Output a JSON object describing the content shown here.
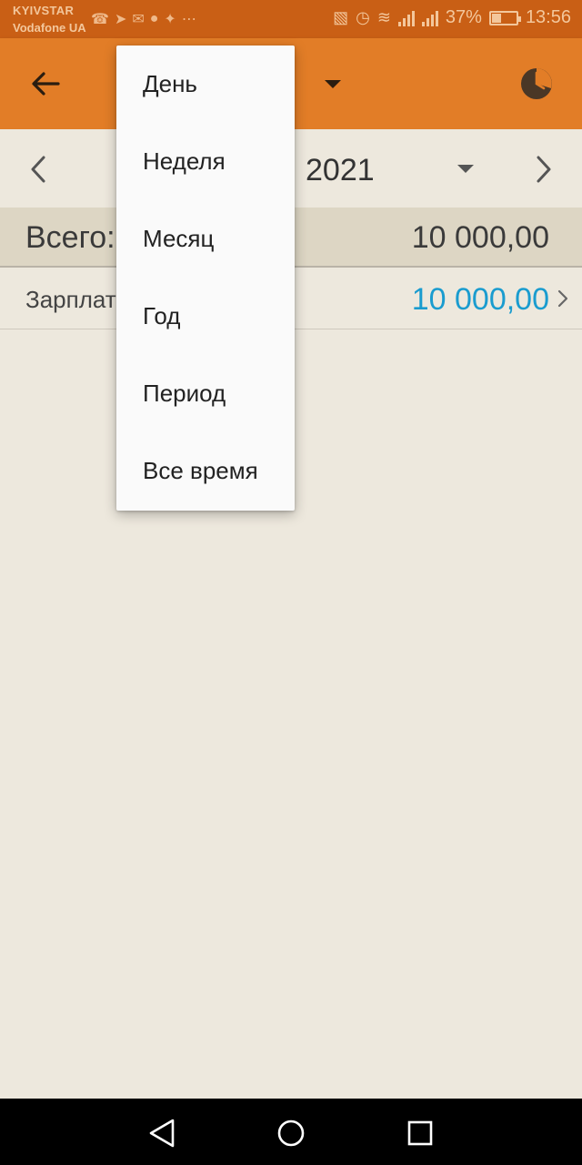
{
  "status_bar": {
    "carrier_1": "KYIVSTAR",
    "carrier_2": "Vodafone UA",
    "app_icons": [
      "viber-icon",
      "telegram-icon",
      "gmail-icon",
      "app-icon",
      "app-icon",
      "more-icon"
    ],
    "battery_percent": "37%",
    "battery_level": 0.37,
    "time": "13:56"
  },
  "app_bar": {
    "colors": {
      "status": "#c95f15",
      "bar": "#e27d27"
    }
  },
  "period": {
    "label": "2021"
  },
  "summary": {
    "total_label": "Всего:",
    "total_value": "10 000,00"
  },
  "categories": [
    {
      "label": "Зарплата",
      "value": "10 000,00",
      "value_color": "#1a9ccf"
    }
  ],
  "dropdown": {
    "items": [
      "День",
      "Неделя",
      "Месяц",
      "Год",
      "Период",
      "Все время"
    ]
  },
  "nav": {
    "icons": [
      "back-triangle-icon",
      "home-circle-icon",
      "recents-square-icon"
    ]
  }
}
